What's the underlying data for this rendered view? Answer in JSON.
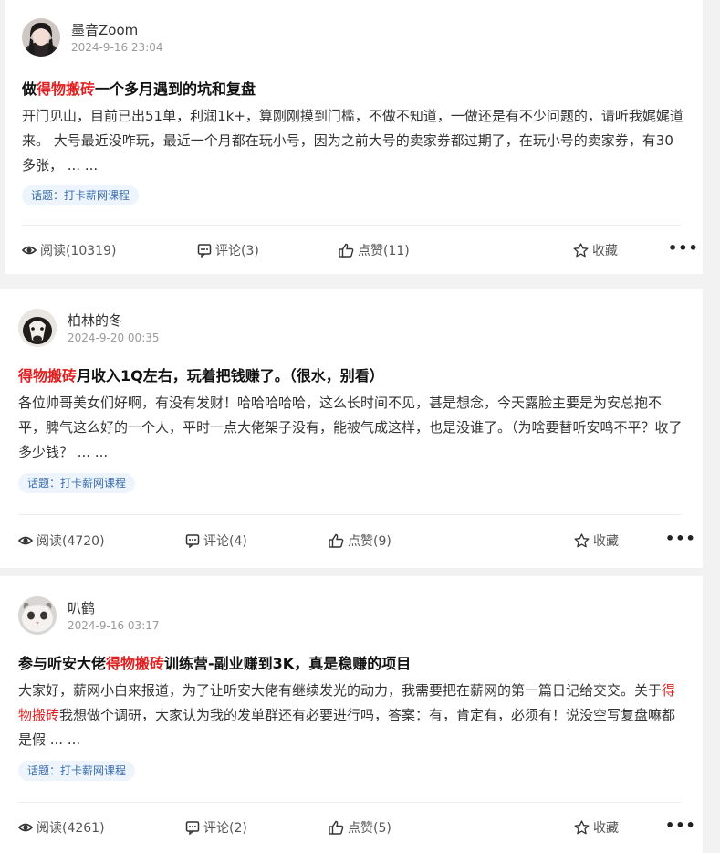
{
  "posts": [
    {
      "author": "墨音Zoom",
      "time": "2024-9-16 23:04",
      "title_prefix": "做",
      "title_highlight": "得物搬砖",
      "title_suffix": "一个多月遇到的坑和复盘",
      "excerpt": "开门见山，目前已出51单，利润1k+，算刚刚摸到门槛，不做不知道，一做还是有不少问题的，请听我娓娓道来。 大号最近没咋玩，最近一个月都在玩小号，因为之前大号的卖家券都过期了，在玩小号的卖家券，有30多张， ... ...",
      "topic": "话题：打卡薪网课程",
      "read": "阅读(10319)",
      "comment": "评论(3)",
      "like": "点赞(11)",
      "favorite": "收藏",
      "more": "•••"
    },
    {
      "author": "柏林的冬",
      "time": "2024-9-20 00:35",
      "title_prefix": "",
      "title_highlight": "得物搬砖",
      "title_suffix": "月收入1Q左右，玩着把钱赚了。（很水，别看）",
      "excerpt": "各位帅哥美女们好啊，有没有发财！哈哈哈哈哈，这么长时间不见，甚是想念，今天露脸主要是为安总抱不平，脾气这么好的一个人，平时一点大佬架子没有，能被气成这样，也是没谁了。（为啥要替听安鸣不平？收了多少钱？ ... ...",
      "topic": "话题：打卡薪网课程",
      "read": "阅读(4720)",
      "comment": "评论(4)",
      "like": "点赞(9)",
      "favorite": "收藏",
      "more": "•••"
    },
    {
      "author": "叭鹤",
      "time": "2024-9-16 03:17",
      "title_prefix": "参与听安大佬",
      "title_highlight": "得物搬砖",
      "title_suffix": "训练营-副业赚到3K，真是稳赚的项目",
      "excerpt_a": "大家好，薪网小白来报道，为了让听安大佬有继续发光的动力，我需要把在薪网的第一篇日记给交交。关于",
      "excerpt_highlight": "得物搬砖",
      "excerpt_b": "我想做个调研，大家认为我的发单群还有必要进行吗，答案：有，肯定有，必须有！说没空写复盘嘛都是假 ... ...",
      "topic": "话题：打卡薪网课程",
      "read": "阅读(4261)",
      "comment": "评论(2)",
      "like": "点赞(5)",
      "favorite": "收藏",
      "more": "•••"
    }
  ],
  "colors": {
    "highlight": "#e02020",
    "topic_bg": "#eef4fb",
    "topic_text": "#3a6fb0"
  },
  "icons": [
    "eye-icon",
    "comment-icon",
    "thumbs-up-icon",
    "star-icon",
    "more-icon"
  ]
}
